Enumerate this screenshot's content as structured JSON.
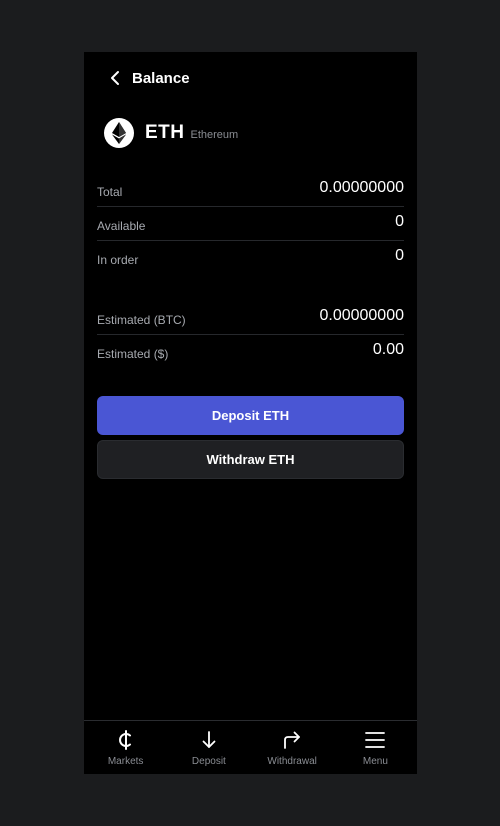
{
  "header": {
    "title": "Balance",
    "back_icon": "chevron-left-icon"
  },
  "asset": {
    "symbol": "ETH",
    "name": "Ethereum",
    "icon": "ethereum-logo-icon"
  },
  "balances": [
    {
      "label": "Total",
      "value": "0.00000000"
    },
    {
      "label": "Available",
      "value": "0"
    },
    {
      "label": "In order",
      "value": "0"
    }
  ],
  "estimates": [
    {
      "label": "Estimated (BTC)",
      "value": "0.00000000"
    },
    {
      "label": "Estimated ($)",
      "value": "0.00"
    }
  ],
  "actions": {
    "deposit_label": "Deposit ETH",
    "withdraw_label": "Withdraw ETH"
  },
  "nav": [
    {
      "label": "Markets",
      "icon": "cedi-icon"
    },
    {
      "label": "Deposit",
      "icon": "arrow-down-icon"
    },
    {
      "label": "Withdrawal",
      "icon": "arrow-turn-right-icon"
    },
    {
      "label": "Menu",
      "icon": "hamburger-menu-icon"
    }
  ],
  "colors": {
    "accent": "#4a56d4",
    "background": "#000000",
    "page": "#1b1c1e"
  }
}
